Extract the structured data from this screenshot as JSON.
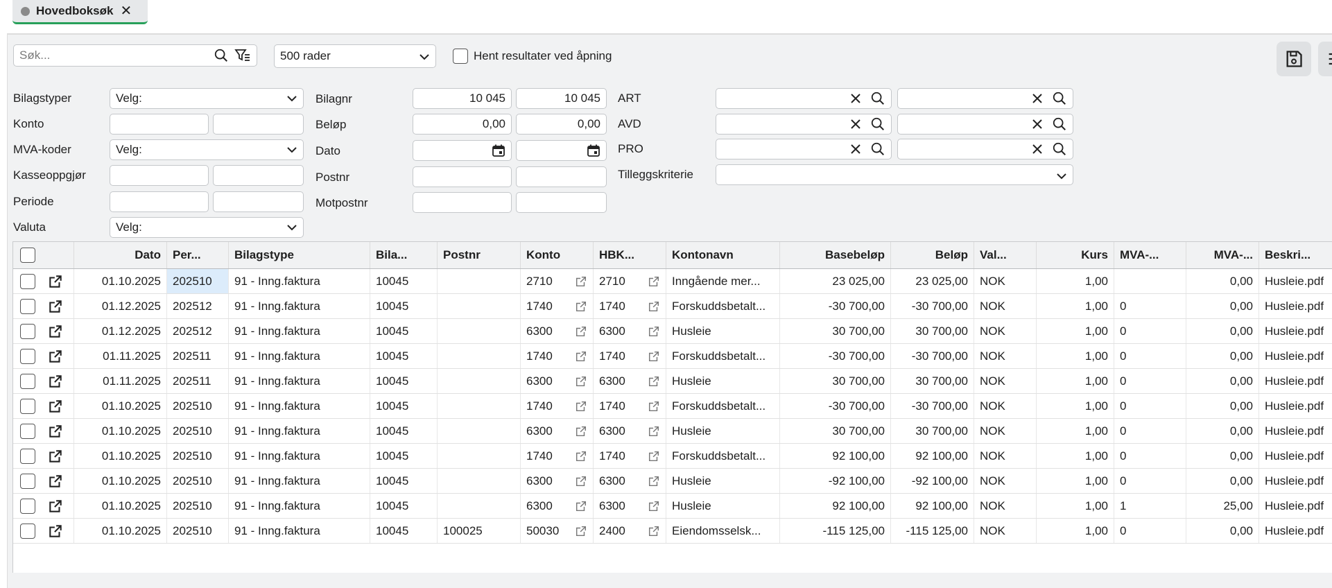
{
  "tab": {
    "title": "Hovedboksøk",
    "close": "✕"
  },
  "toolbar": {
    "search_placeholder": "Søk...",
    "rows_select": "500 rader",
    "fetch_on_open_label": "Hent resultater ved åpning"
  },
  "filters": {
    "bilagstyper": {
      "label": "Bilagstyper",
      "value": "Velg:"
    },
    "konto": {
      "label": "Konto"
    },
    "mva_koder": {
      "label": "MVA-koder",
      "value": "Velg:"
    },
    "kasseoppgjor": {
      "label": "Kasseoppgjør"
    },
    "periode": {
      "label": "Periode"
    },
    "valuta": {
      "label": "Valuta",
      "value": "Velg:"
    },
    "bilagnr": {
      "label": "Bilagnr",
      "from": "10 045",
      "to": "10 045"
    },
    "belop": {
      "label": "Beløp",
      "from": "0,00",
      "to": "0,00"
    },
    "dato": {
      "label": "Dato"
    },
    "postnr": {
      "label": "Postnr"
    },
    "motpostnr": {
      "label": "Motpostnr"
    },
    "art": {
      "label": "ART"
    },
    "avd": {
      "label": "AVD"
    },
    "pro": {
      "label": "PRO"
    },
    "tilleggskriterie": {
      "label": "Tilleggskriterie"
    }
  },
  "table": {
    "headers": {
      "dato": "Dato",
      "periode": "Per...",
      "bilagstype": "Bilagstype",
      "bilagnr": "Bila...",
      "postnr": "Postnr",
      "konto": "Konto",
      "hbk": "HBK...",
      "kontonavn": "Kontonavn",
      "basebelop": "Basebeløp",
      "belop": "Beløp",
      "valuta": "Val...",
      "kurs": "Kurs",
      "mvakode": "MVA-...",
      "mvabelop": "MVA-...",
      "beskrivelse": "Beskri..."
    },
    "rows": [
      {
        "dato": "01.10.2025",
        "periode": "202510",
        "bilagstype": "91 - Inng.faktura",
        "bilagnr": "10045",
        "postnr": "",
        "konto": "2710",
        "hbk": "2710",
        "kontonavn": "Inngående mer...",
        "basebelop": "23 025,00",
        "belop": "23 025,00",
        "valuta": "NOK",
        "kurs": "1,00",
        "mvakode": "",
        "mvabelop": "0,00",
        "beskrivelse": "Husleie.pdf"
      },
      {
        "dato": "01.12.2025",
        "periode": "202512",
        "bilagstype": "91 - Inng.faktura",
        "bilagnr": "10045",
        "postnr": "",
        "konto": "1740",
        "hbk": "1740",
        "kontonavn": "Forskuddsbetalt...",
        "basebelop": "-30 700,00",
        "belop": "-30 700,00",
        "valuta": "NOK",
        "kurs": "1,00",
        "mvakode": "0",
        "mvabelop": "0,00",
        "beskrivelse": "Husleie.pdf"
      },
      {
        "dato": "01.12.2025",
        "periode": "202512",
        "bilagstype": "91 - Inng.faktura",
        "bilagnr": "10045",
        "postnr": "",
        "konto": "6300",
        "hbk": "6300",
        "kontonavn": "Husleie",
        "basebelop": "30 700,00",
        "belop": "30 700,00",
        "valuta": "NOK",
        "kurs": "1,00",
        "mvakode": "0",
        "mvabelop": "0,00",
        "beskrivelse": "Husleie.pdf"
      },
      {
        "dato": "01.11.2025",
        "periode": "202511",
        "bilagstype": "91 - Inng.faktura",
        "bilagnr": "10045",
        "postnr": "",
        "konto": "1740",
        "hbk": "1740",
        "kontonavn": "Forskuddsbetalt...",
        "basebelop": "-30 700,00",
        "belop": "-30 700,00",
        "valuta": "NOK",
        "kurs": "1,00",
        "mvakode": "0",
        "mvabelop": "0,00",
        "beskrivelse": "Husleie.pdf"
      },
      {
        "dato": "01.11.2025",
        "periode": "202511",
        "bilagstype": "91 - Inng.faktura",
        "bilagnr": "10045",
        "postnr": "",
        "konto": "6300",
        "hbk": "6300",
        "kontonavn": "Husleie",
        "basebelop": "30 700,00",
        "belop": "30 700,00",
        "valuta": "NOK",
        "kurs": "1,00",
        "mvakode": "0",
        "mvabelop": "0,00",
        "beskrivelse": "Husleie.pdf"
      },
      {
        "dato": "01.10.2025",
        "periode": "202510",
        "bilagstype": "91 - Inng.faktura",
        "bilagnr": "10045",
        "postnr": "",
        "konto": "1740",
        "hbk": "1740",
        "kontonavn": "Forskuddsbetalt...",
        "basebelop": "-30 700,00",
        "belop": "-30 700,00",
        "valuta": "NOK",
        "kurs": "1,00",
        "mvakode": "0",
        "mvabelop": "0,00",
        "beskrivelse": "Husleie.pdf"
      },
      {
        "dato": "01.10.2025",
        "periode": "202510",
        "bilagstype": "91 - Inng.faktura",
        "bilagnr": "10045",
        "postnr": "",
        "konto": "6300",
        "hbk": "6300",
        "kontonavn": "Husleie",
        "basebelop": "30 700,00",
        "belop": "30 700,00",
        "valuta": "NOK",
        "kurs": "1,00",
        "mvakode": "0",
        "mvabelop": "0,00",
        "beskrivelse": "Husleie.pdf"
      },
      {
        "dato": "01.10.2025",
        "periode": "202510",
        "bilagstype": "91 - Inng.faktura",
        "bilagnr": "10045",
        "postnr": "",
        "konto": "1740",
        "hbk": "1740",
        "kontonavn": "Forskuddsbetalt...",
        "basebelop": "92 100,00",
        "belop": "92 100,00",
        "valuta": "NOK",
        "kurs": "1,00",
        "mvakode": "0",
        "mvabelop": "0,00",
        "beskrivelse": "Husleie.pdf"
      },
      {
        "dato": "01.10.2025",
        "periode": "202510",
        "bilagstype": "91 - Inng.faktura",
        "bilagnr": "10045",
        "postnr": "",
        "konto": "6300",
        "hbk": "6300",
        "kontonavn": "Husleie",
        "basebelop": "-92 100,00",
        "belop": "-92 100,00",
        "valuta": "NOK",
        "kurs": "1,00",
        "mvakode": "0",
        "mvabelop": "0,00",
        "beskrivelse": "Husleie.pdf"
      },
      {
        "dato": "01.10.2025",
        "periode": "202510",
        "bilagstype": "91 - Inng.faktura",
        "bilagnr": "10045",
        "postnr": "",
        "konto": "6300",
        "hbk": "6300",
        "kontonavn": "Husleie",
        "basebelop": "92 100,00",
        "belop": "92 100,00",
        "valuta": "NOK",
        "kurs": "1,00",
        "mvakode": "1",
        "mvabelop": "25,00",
        "beskrivelse": "Husleie.pdf"
      },
      {
        "dato": "01.10.2025",
        "periode": "202510",
        "bilagstype": "91 - Inng.faktura",
        "bilagnr": "10045",
        "postnr": "100025",
        "konto": "50030",
        "hbk": "2400",
        "kontonavn": "Eiendomsselsk...",
        "basebelop": "-115 125,00",
        "belop": "-115 125,00",
        "valuta": "NOK",
        "kurs": "1,00",
        "mvakode": "0",
        "mvabelop": "0,00",
        "beskrivelse": "Husleie.pdf"
      }
    ]
  }
}
